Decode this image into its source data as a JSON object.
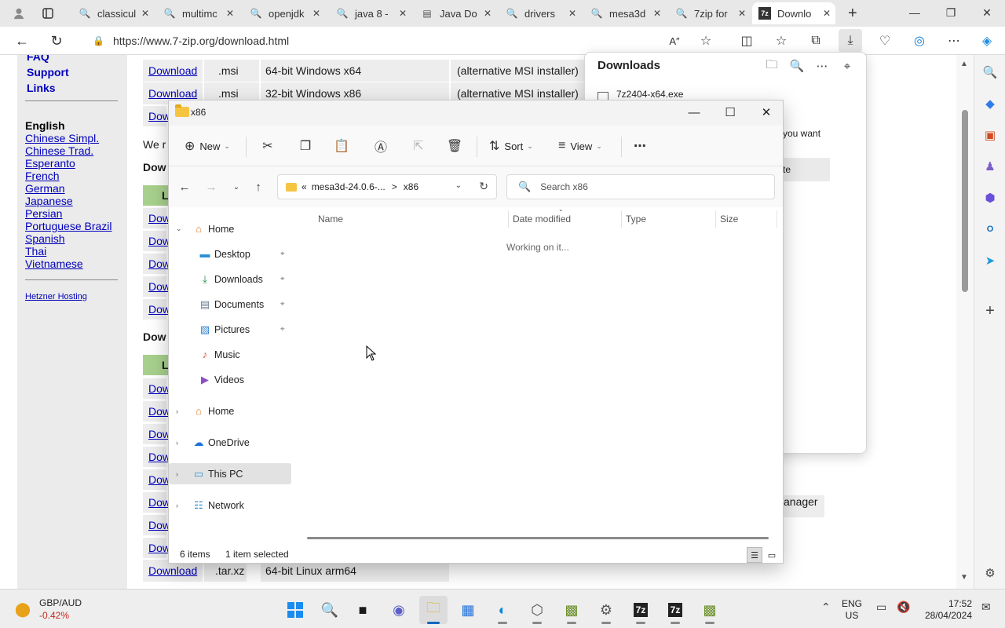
{
  "browser": {
    "tabs": [
      {
        "label": "classicul",
        "icon": "search-icon"
      },
      {
        "label": "multimc",
        "icon": "search-icon"
      },
      {
        "label": "openjdk",
        "icon": "search-icon"
      },
      {
        "label": "java 8 -",
        "icon": "search-icon"
      },
      {
        "label": "Java Do",
        "icon": "doc-icon"
      },
      {
        "label": "drivers",
        "icon": "search-icon"
      },
      {
        "label": "mesa3d",
        "icon": "search-icon"
      },
      {
        "label": "7zip for",
        "icon": "search-icon"
      },
      {
        "label": "Downlo",
        "icon": "7zip-icon"
      }
    ],
    "url": "https://www.7-zip.org/download.html"
  },
  "page": {
    "nav": [
      "FAQ",
      "Support",
      "Links"
    ],
    "lang_heading": "English",
    "languages": [
      "Chinese Simpl.",
      "Chinese Trad.",
      "Esperanto",
      "French",
      "German",
      "Japanese",
      "Persian",
      "Portuguese Brazil",
      "Spanish",
      "Thai",
      "Vietnamese"
    ],
    "hosting": "Hetzner Hosting",
    "rows": [
      {
        "link": "Download",
        "type": ".msi",
        "desc": "64-bit Windows x64",
        "note": "(alternative MSI installer)"
      },
      {
        "link": "Download",
        "type": ".msi",
        "desc": "32-bit Windows x86",
        "note": "(alternative MSI installer)"
      }
    ],
    "row_stub": "Dow",
    "we_text": "We r",
    "section_heading": "Dow",
    "green_letter": "L",
    "last_row": {
      "link": "Download",
      "type": ".tar.xz",
      "desc": "64-bit Linux arm64"
    },
    "manager_text": "anager"
  },
  "downloads_panel": {
    "title": "Downloads",
    "file": "7z2404-x64.exe",
    "you_want": "you want",
    "te": "te"
  },
  "explorer": {
    "title": "x86",
    "toolbar": {
      "new": "New",
      "sort": "Sort",
      "view": "View"
    },
    "breadcrumb": {
      "prefix": "«",
      "parent": "mesa3d-24.0.6-...",
      "sep": ">",
      "current": "x86"
    },
    "search_placeholder": "Search x86",
    "pane": [
      {
        "label": "Home",
        "icon": "home-icon",
        "expanded": true
      },
      {
        "label": "Desktop",
        "icon": "desktop-icon",
        "pinned": true
      },
      {
        "label": "Downloads",
        "icon": "download-icon",
        "pinned": true
      },
      {
        "label": "Documents",
        "icon": "documents-icon",
        "pinned": true
      },
      {
        "label": "Pictures",
        "icon": "pictures-icon",
        "pinned": true
      },
      {
        "label": "Music",
        "icon": "music-icon"
      },
      {
        "label": "Videos",
        "icon": "videos-icon"
      },
      {
        "label": "Home",
        "icon": "home-icon"
      },
      {
        "label": "OneDrive",
        "icon": "onedrive-icon"
      },
      {
        "label": "This PC",
        "icon": "pc-icon",
        "selected": true
      },
      {
        "label": "Network",
        "icon": "network-icon"
      }
    ],
    "columns": [
      "Name",
      "Date modified",
      "Type",
      "Size"
    ],
    "status_working": "Working on it...",
    "items_count": "6 items",
    "selected_count": "1 item selected"
  },
  "taskbar": {
    "weather_name": "GBP/AUD",
    "weather_change": "-0.42%",
    "lang1": "ENG",
    "lang2": "US",
    "time": "17:52",
    "date": "28/04/2024"
  }
}
